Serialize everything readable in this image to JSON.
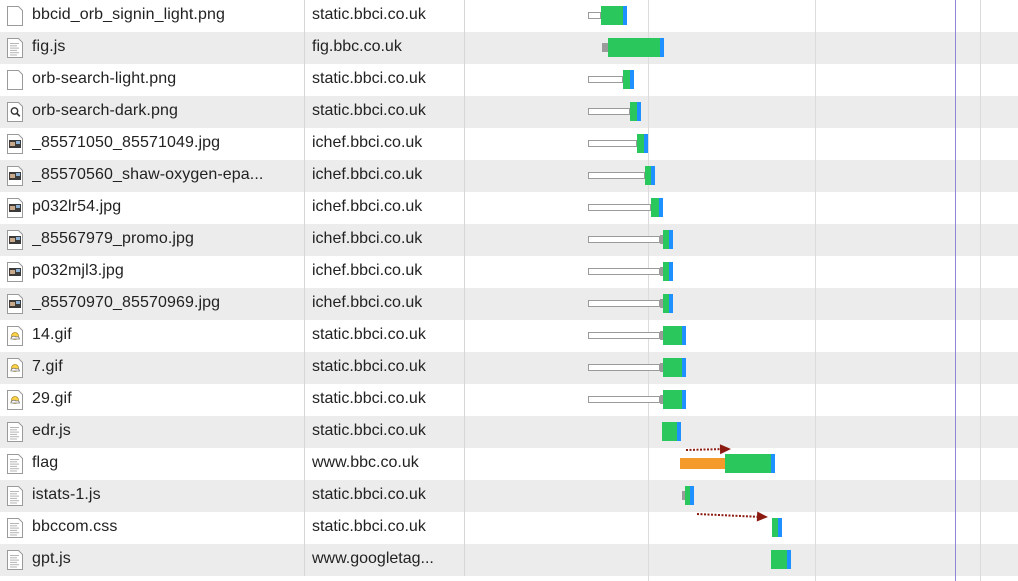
{
  "colors": {
    "row_alt": "#ececec",
    "receiving": "#2ac85c",
    "blocking": "#f39a2b",
    "load_event": "#8c87d8",
    "arrow": "#8b1a10"
  },
  "requests": [
    {
      "name": "bbcid_orb_signin_light.png",
      "domain": "static.bbci.co.uk",
      "icon": "image-file-blank-icon"
    },
    {
      "name": "fig.js",
      "domain": "fig.bbc.co.uk",
      "icon": "script-file-icon"
    },
    {
      "name": "orb-search-light.png",
      "domain": "static.bbci.co.uk",
      "icon": "image-file-blank-icon"
    },
    {
      "name": "orb-search-dark.png",
      "domain": "static.bbci.co.uk",
      "icon": "search-image-icon"
    },
    {
      "name": "_85571050_85571049.jpg",
      "domain": "ichef.bbci.co.uk",
      "icon": "photo-thumbnail-icon"
    },
    {
      "name": "_85570560_shaw-oxygen-epa...",
      "domain": "ichef.bbci.co.uk",
      "icon": "photo-thumbnail-icon"
    },
    {
      "name": "p032lr54.jpg",
      "domain": "ichef.bbci.co.uk",
      "icon": "photo-thumbnail-icon"
    },
    {
      "name": "_85567979_promo.jpg",
      "domain": "ichef.bbci.co.uk",
      "icon": "photo-thumbnail-icon"
    },
    {
      "name": "p032mjl3.jpg",
      "domain": "ichef.bbci.co.uk",
      "icon": "photo-thumbnail-icon"
    },
    {
      "name": "_85570970_85570969.jpg",
      "domain": "ichef.bbci.co.uk",
      "icon": "photo-thumbnail-icon"
    },
    {
      "name": "14.gif",
      "domain": "static.bbci.co.uk",
      "icon": "weather-gif-icon"
    },
    {
      "name": "7.gif",
      "domain": "static.bbci.co.uk",
      "icon": "weather-gif-icon"
    },
    {
      "name": "29.gif",
      "domain": "static.bbci.co.uk",
      "icon": "weather-gif-icon"
    },
    {
      "name": "edr.js",
      "domain": "static.bbci.co.uk",
      "icon": "script-file-icon"
    },
    {
      "name": "flag",
      "domain": "www.bbc.co.uk",
      "icon": "script-file-icon"
    },
    {
      "name": "istats-1.js",
      "domain": "static.bbci.co.uk",
      "icon": "script-file-icon"
    },
    {
      "name": "bbccom.css",
      "domain": "static.bbci.co.uk",
      "icon": "stylesheet-file-icon"
    },
    {
      "name": "gpt.js",
      "domain": "www.googletag...",
      "icon": "script-file-icon"
    }
  ]
}
